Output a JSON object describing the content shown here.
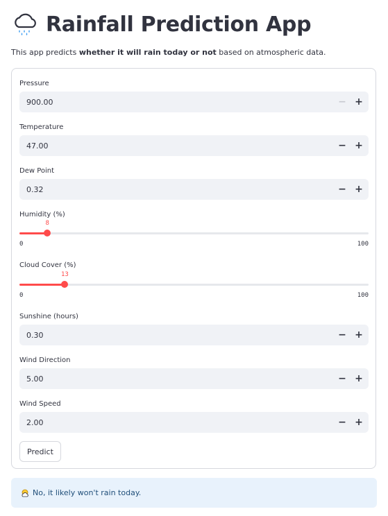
{
  "header": {
    "title": "Rainfall Prediction App",
    "icon": "rain-cloud-icon"
  },
  "description": {
    "prefix": "This app predicts ",
    "bold": "whether it will rain today or not",
    "suffix": " based on atmospheric data."
  },
  "form": {
    "pressure": {
      "label": "Pressure",
      "value": "900.00"
    },
    "temperature": {
      "label": "Temperature",
      "value": "47.00"
    },
    "dew_point": {
      "label": "Dew Point",
      "value": "0.32"
    },
    "humidity": {
      "label": "Humidity (%)",
      "value": 8,
      "value_label": "8",
      "min": 0,
      "max": 100,
      "min_label": "0",
      "max_label": "100"
    },
    "cloud_cover": {
      "label": "Cloud Cover (%)",
      "value": 13,
      "value_label": "13",
      "min": 0,
      "max": 100,
      "min_label": "0",
      "max_label": "100"
    },
    "sunshine": {
      "label": "Sunshine (hours)",
      "value": "0.30"
    },
    "wind_direction": {
      "label": "Wind Direction",
      "value": "5.00"
    },
    "wind_speed": {
      "label": "Wind Speed",
      "value": "2.00"
    },
    "minus_symbol": "−",
    "plus_symbol": "+",
    "predict_label": "Predict"
  },
  "result": {
    "icon": "sun-behind-cloud-icon",
    "text": "No, it likely won't rain today."
  },
  "colors": {
    "accent": "#ff4b4b",
    "text": "#31333f",
    "input_bg": "#f0f2f6",
    "info_bg": "#e8f2fc",
    "info_text": "#1f4e79"
  }
}
